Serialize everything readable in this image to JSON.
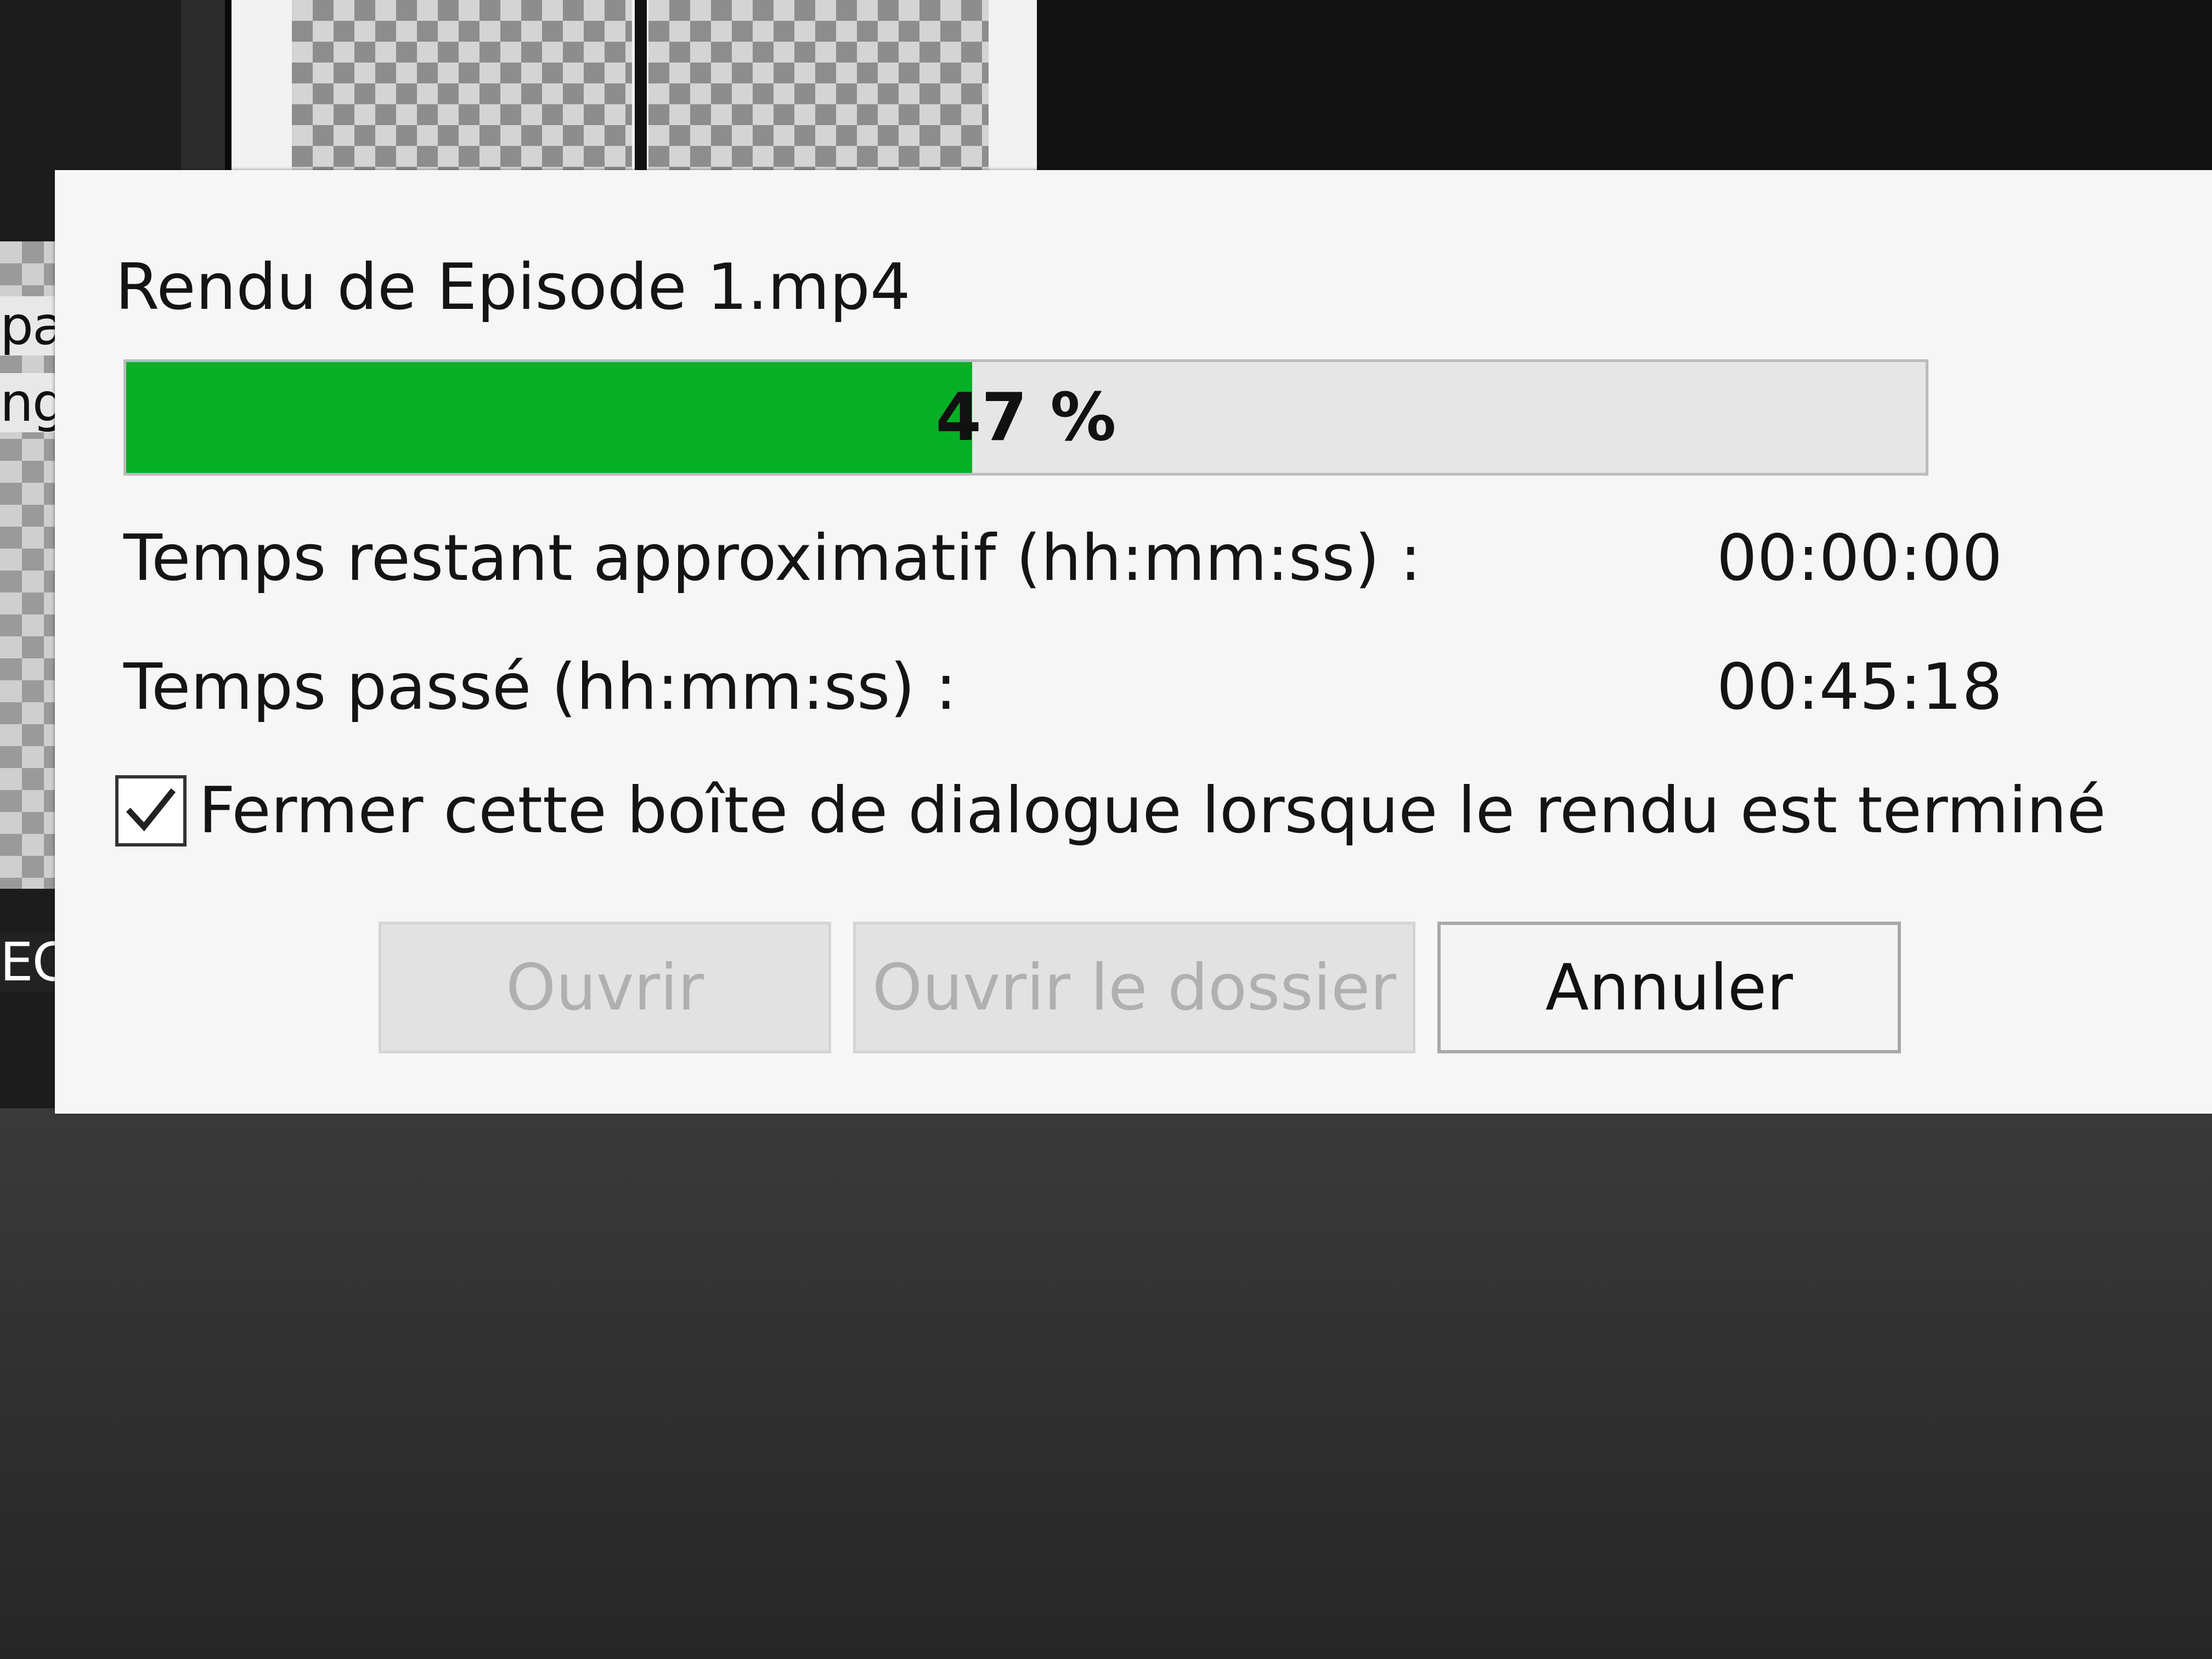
{
  "background": {
    "left_fragments": [
      "pa",
      "ng",
      "EC"
    ]
  },
  "dialog": {
    "title": "Rendu de Episode 1.mp4",
    "progress": {
      "percent": 47,
      "label": "47 %",
      "fill_color": "#06b025"
    },
    "remaining": {
      "label": "Temps restant approximatif (hh:mm:ss) :",
      "value": "00:00:00"
    },
    "elapsed": {
      "label": "Temps passé (hh:mm:ss) :",
      "value": "00:45:18"
    },
    "close_on_finish": {
      "label": "Fermer cette boîte de dialogue lorsque le rendu est terminé",
      "checked": true,
      "icon": "checkmark-icon"
    },
    "buttons": {
      "open": "Ouvrir",
      "open_folder": "Ouvrir le dossier",
      "cancel": "Annuler"
    }
  }
}
